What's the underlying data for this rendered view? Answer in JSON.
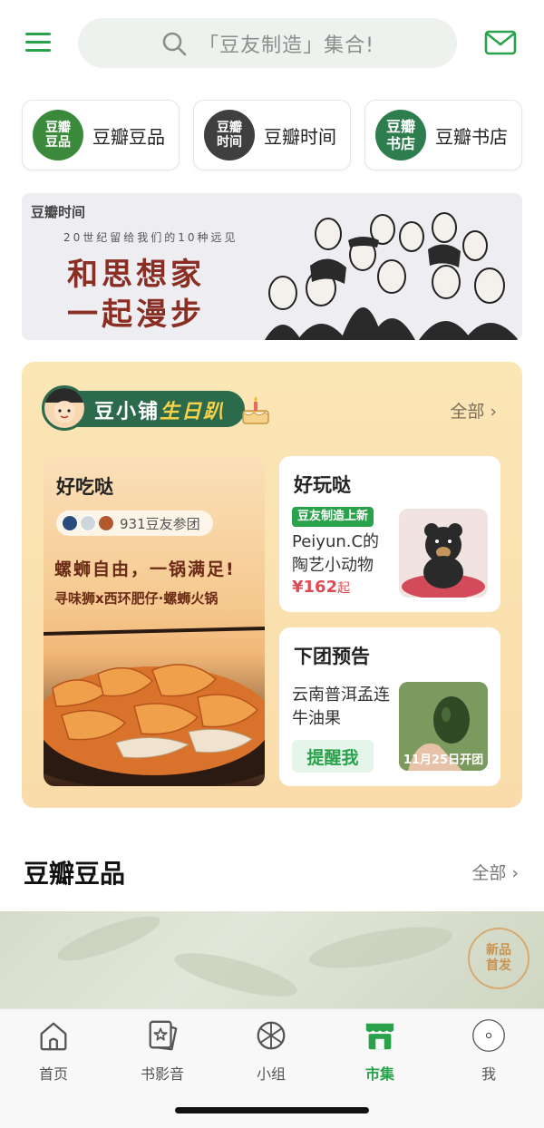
{
  "header": {
    "search_placeholder": "「豆友制造」集合!",
    "accent": "#2aa24b"
  },
  "categories": [
    {
      "logo_line1": "豆瓣",
      "logo_line2": "豆品",
      "label": "豆瓣豆品",
      "logo_color": "#3b8a3c"
    },
    {
      "logo_line1": "豆瓣",
      "logo_line2": "时间",
      "label": "豆瓣时间",
      "logo_color": "#3f3f3f"
    },
    {
      "logo_line1": "豆瓣",
      "logo_line2": "书店",
      "label": "豆瓣书店",
      "logo_color": "#2e7d4f"
    }
  ],
  "banner": {
    "brand": "豆瓣时间",
    "subtitle": "20世纪留给我们的10种远见",
    "title_line1": "和思想家",
    "title_line2": "一起漫步"
  },
  "shop": {
    "title": "豆小铺",
    "title_accent": "生日趴",
    "all_label": "全部 ›",
    "left_card": {
      "title": "好吃哒",
      "participants": "931豆友参团",
      "slogan": "螺蛳自由，一锅满足!",
      "desc": "寻味狮x西环肥仔·螺蛳火锅"
    },
    "right_top": {
      "title": "好玩哒",
      "tag": "豆友制造上新",
      "text": "Peiyun.C的陶艺小动物",
      "price": "¥162",
      "price_suffix": "起"
    },
    "right_bottom": {
      "title": "下团预告",
      "text": "云南普洱孟连牛油果",
      "remind_label": "提醒我",
      "date_label": "11月25日开团"
    }
  },
  "section2": {
    "title": "豆瓣豆品",
    "all_label": "全部 ›",
    "stamp_line1": "新品",
    "stamp_line2": "首发"
  },
  "tabbar": {
    "items": [
      {
        "label": "首页"
      },
      {
        "label": "书影音"
      },
      {
        "label": "小组"
      },
      {
        "label": "市集",
        "active": true
      },
      {
        "label": "我"
      }
    ]
  }
}
